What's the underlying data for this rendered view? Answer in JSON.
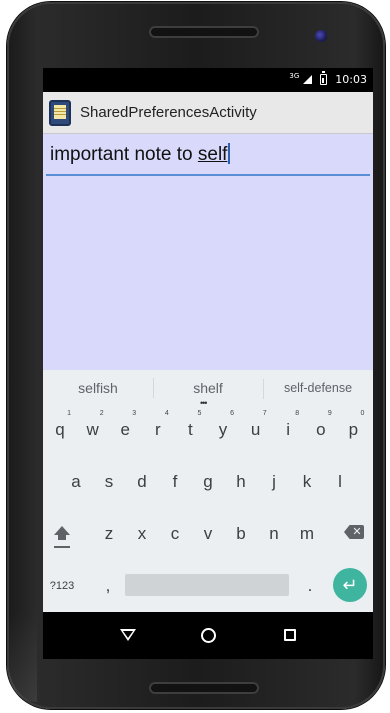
{
  "status_bar": {
    "network": "3G",
    "time": "10:03"
  },
  "action_bar": {
    "title": "SharedPreferencesActivity"
  },
  "note": {
    "text_before": "important note to ",
    "current_word": "self"
  },
  "keyboard": {
    "suggestions": [
      "selfish",
      "shelf",
      "self-defense"
    ],
    "row1": [
      {
        "key": "q",
        "hint": "1"
      },
      {
        "key": "w",
        "hint": "2"
      },
      {
        "key": "e",
        "hint": "3"
      },
      {
        "key": "r",
        "hint": "4"
      },
      {
        "key": "t",
        "hint": "5"
      },
      {
        "key": "y",
        "hint": "6"
      },
      {
        "key": "u",
        "hint": "7"
      },
      {
        "key": "i",
        "hint": "8"
      },
      {
        "key": "o",
        "hint": "9"
      },
      {
        "key": "p",
        "hint": "0"
      }
    ],
    "row2": [
      "a",
      "s",
      "d",
      "f",
      "g",
      "h",
      "j",
      "k",
      "l"
    ],
    "row3": [
      "z",
      "x",
      "c",
      "v",
      "b",
      "n",
      "m"
    ],
    "symbols_label": "?123",
    "comma": ",",
    "period": ".",
    "icons": {
      "shift": "shift-icon",
      "backspace": "backspace-icon",
      "enter": "enter-icon"
    },
    "enter_color": "#3fb59f"
  },
  "nav_bar": {
    "icons": [
      "back-icon",
      "home-icon",
      "recent-apps-icon"
    ]
  },
  "colors": {
    "content_background": "#d9d9fb",
    "action_bar": "#e8e8e8",
    "input_underline": "#5a8fd6"
  }
}
